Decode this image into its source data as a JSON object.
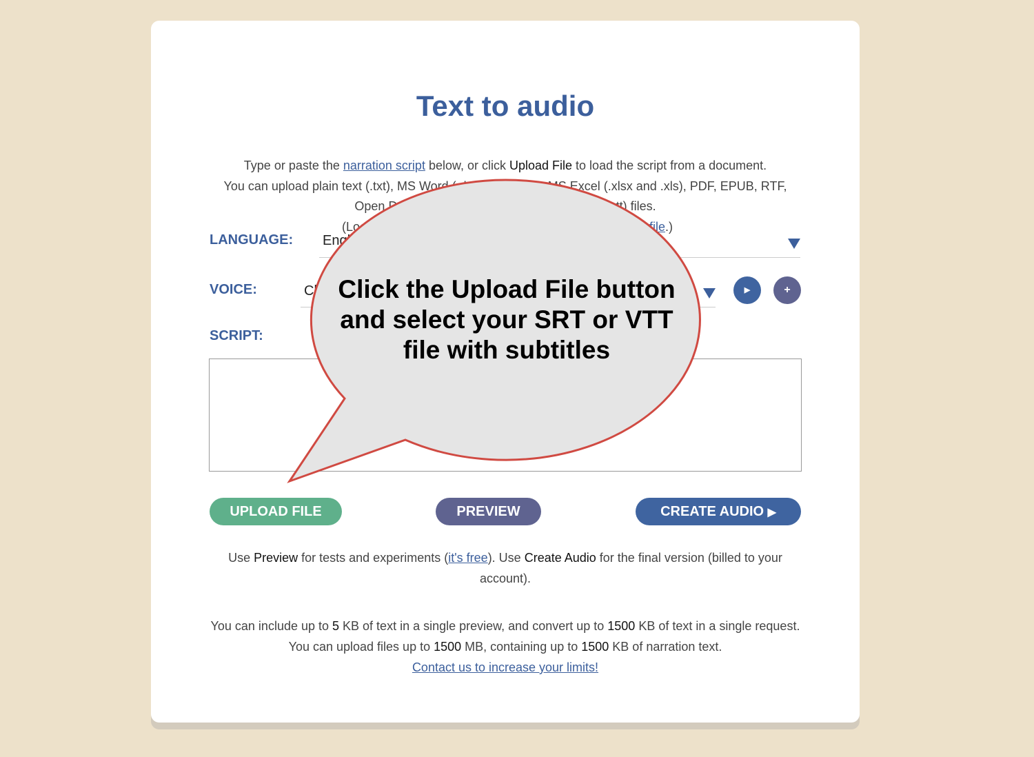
{
  "title": "Text to audio",
  "intro": {
    "l1a": "Type or paste the ",
    "l1link": "narration script",
    "l1b": " below, or click ",
    "l1bold": "Upload File",
    "l1c": " to load the script from a document.",
    "l2": "You can upload plain text (.txt), MS Word (.docx and .doc), MS Excel (.xlsx and .xls), PDF, EPUB, RTF,",
    "l3": "Open Document (.odt, .ods) and subtitle (.srt, .vtt) files.",
    "l4a": "(Looki",
    "l4link": "is file",
    "l4b": ".)"
  },
  "language": {
    "label": "LANGUAGE:",
    "value": "Engl"
  },
  "voice": {
    "label": "VOICE:",
    "value": "Cl",
    "play_icon": "play-icon",
    "add_icon": "plus-icon"
  },
  "script": {
    "label": "SCRIPT:",
    "value": ""
  },
  "buttons": {
    "upload": "UPLOAD FILE",
    "preview": "PREVIEW",
    "create": "CREATE AUDIO",
    "create_icon": "▶"
  },
  "colors": {
    "upload": "#5fb08b",
    "preview": "#5f6390",
    "create": "#3f64a0",
    "accent": "#3c5f9c",
    "callout_border": "#d04a42"
  },
  "foot1": {
    "a": "Use ",
    "b1": "Preview",
    "c": " for tests and experiments (",
    "link": "it's free",
    "d": "). Use ",
    "b2": "Create Audio",
    "e": " for the final version (billed to your account)."
  },
  "foot2": {
    "a": "You can include up to ",
    "n1": "5",
    "b": " KB of text in a single preview, and convert up to ",
    "n2": "1500",
    "c": " KB of text in a single request. You can upload files up to ",
    "n3": "1500",
    "d": " MB, containing up to ",
    "n4": "1500",
    "e": " KB of narration text.",
    "link": "Contact us to increase your limits!"
  },
  "callout": "Click the Upload File button and select your SRT or VTT file with subtitles"
}
